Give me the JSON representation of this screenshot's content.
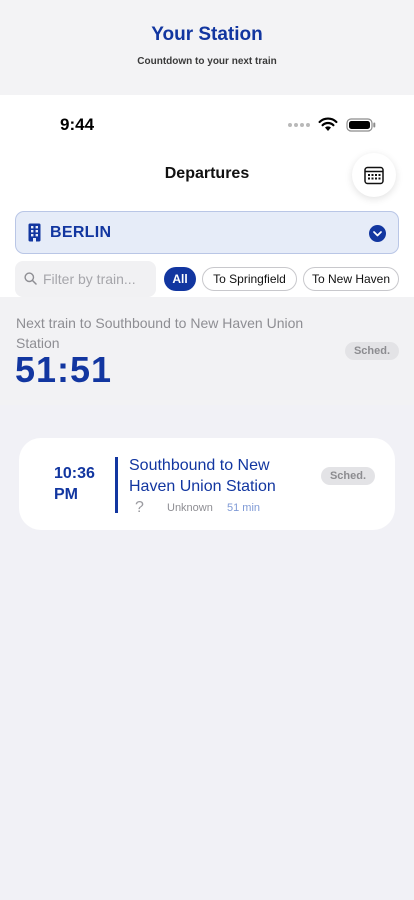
{
  "promo": {
    "title": "Your Station",
    "subtitle": "Countdown to your next train"
  },
  "status_bar": {
    "time": "9:44"
  },
  "nav": {
    "title": "Departures",
    "calendar_icon": "calendar-icon"
  },
  "station": {
    "name": "BERLIN",
    "icon": "building-icon"
  },
  "filters": {
    "search_placeholder": "Filter by train...",
    "search_value": "",
    "chips": [
      "All",
      "To Springfield",
      "To New Haven"
    ],
    "selected": "All"
  },
  "next_train": {
    "label": "Next train to Southbound to New Haven Union Station",
    "countdown": "51:51",
    "status": "Sched."
  },
  "departures": [
    {
      "time": "10:36 PM",
      "destination": "Southbound to New Haven Union Station",
      "track": "?",
      "train": "Unknown",
      "minutes": "51 min",
      "status": "Sched."
    }
  ],
  "colors": {
    "accent": "#1236a0",
    "background": "#f1f1f6",
    "station_bg": "#e6ecf8"
  }
}
